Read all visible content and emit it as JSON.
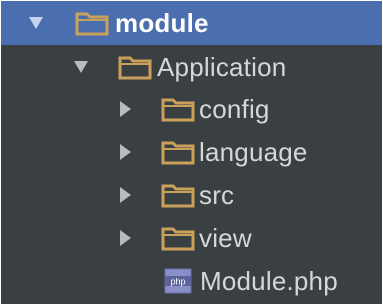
{
  "tree": {
    "root": {
      "label": "module",
      "expanded": true,
      "selected": true,
      "icon": "folder-icon"
    },
    "application": {
      "label": "Application",
      "expanded": true,
      "icon": "folder-icon"
    },
    "children": [
      {
        "label": "config",
        "expanded": false,
        "icon": "folder-icon"
      },
      {
        "label": "language",
        "expanded": false,
        "icon": "folder-icon"
      },
      {
        "label": "src",
        "expanded": false,
        "icon": "folder-icon"
      },
      {
        "label": "view",
        "expanded": false,
        "icon": "folder-icon"
      }
    ],
    "file": {
      "label": "Module.php",
      "icon": "php-file-icon",
      "badge": "php"
    }
  },
  "colors": {
    "background": "#3a3f42",
    "selection": "#4b6eaf",
    "folder": "#c9a15a",
    "text": "#d4d7d9"
  }
}
